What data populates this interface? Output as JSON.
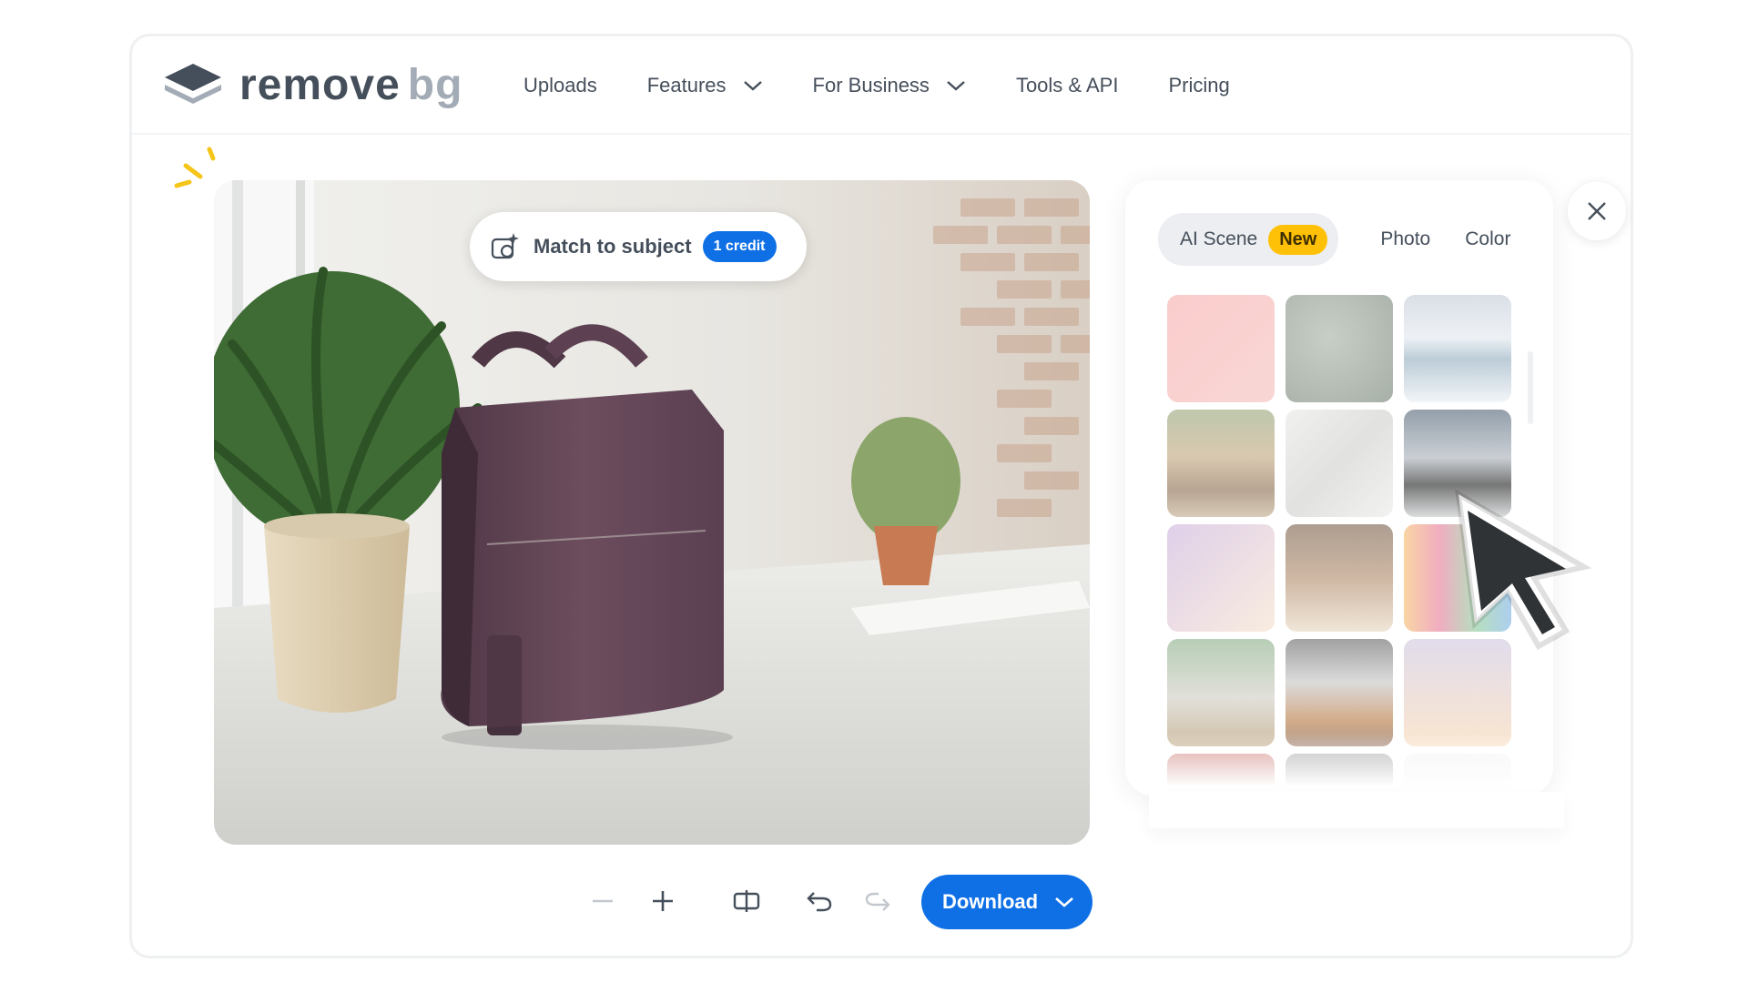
{
  "brand": {
    "word1": "remove",
    "word2": "bg"
  },
  "nav": {
    "items": [
      {
        "label": "Uploads",
        "has_dropdown": false
      },
      {
        "label": "Features",
        "has_dropdown": true
      },
      {
        "label": "For Business",
        "has_dropdown": true
      },
      {
        "label": "Tools & API",
        "has_dropdown": false
      },
      {
        "label": "Pricing",
        "has_dropdown": false
      }
    ]
  },
  "editor": {
    "match_to_subject": {
      "label": "Match to subject",
      "badge": "1 credit",
      "icon": "sparkle-camera-icon"
    },
    "image_subject": "purple leather bag on desk with potted plants"
  },
  "background_panel": {
    "tabs": [
      {
        "label": "AI Scene",
        "badge": "New",
        "active": true
      },
      {
        "label": "Photo",
        "active": false
      },
      {
        "label": "Color",
        "active": false
      }
    ],
    "thumbnails": [
      "pink-gradient",
      "rain-glass",
      "icy-landscape",
      "wooden-cabin",
      "white-silk",
      "office-desk",
      "lavender-gradient",
      "cafe-croissant",
      "rainbow-gradient",
      "plant-tea",
      "shoes-wooden",
      "sunset-gradient",
      "red-interior",
      "bridge-structure",
      "light-gradient"
    ],
    "selected_thumbnail": "office-desk"
  },
  "toolbar": {
    "tools": [
      "zoom-out-icon",
      "zoom-in-icon",
      "compare-icon",
      "undo-icon",
      "redo-icon"
    ],
    "download_label": "Download"
  },
  "colors": {
    "accent": "#0f70e6",
    "badge_yellow": "#ffc107",
    "text": "#454f5b",
    "logo_light": "#a3acb6"
  }
}
